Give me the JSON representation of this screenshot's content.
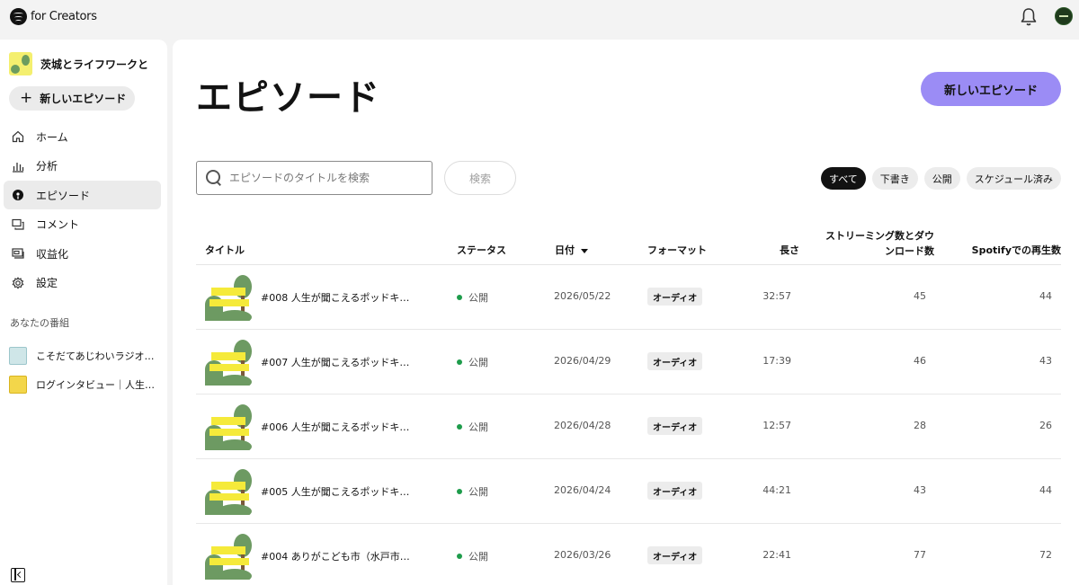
{
  "topbar": {
    "brand": "for Creators",
    "icons": [
      "spotify-logo-icon",
      "bell-icon",
      "avatar"
    ]
  },
  "sidebar": {
    "show_title": "茨城とライフワークと",
    "new_episode": "新しいエピソード",
    "nav": [
      {
        "label": "ホーム",
        "icon": "home-icon"
      },
      {
        "label": "分析",
        "icon": "chart-icon"
      },
      {
        "label": "エピソード",
        "icon": "podcast-icon",
        "active": true
      },
      {
        "label": "コメント",
        "icon": "comment-icon"
      },
      {
        "label": "収益化",
        "icon": "monetize-icon"
      },
      {
        "label": "設定",
        "icon": "gear-icon"
      }
    ],
    "section_label": "あなたの番組",
    "my_shows": [
      {
        "title": "こそだてあじわいラジオ…"
      },
      {
        "title": "ログインタビュー｜人生…"
      }
    ]
  },
  "main": {
    "title": "エピソード",
    "new_episode_button": "新しいエピソード",
    "search_placeholder": "エピソードのタイトルを検索",
    "search_button": "検索",
    "filters": [
      "すべて",
      "下書き",
      "公開",
      "スケジュール済み"
    ],
    "active_filter": "すべて",
    "columns": {
      "title": "タイトル",
      "status": "ステータス",
      "date": "日付",
      "format": "フォーマット",
      "length": "長さ",
      "streams_line1": "ストリーミング数とダウ",
      "streams_line2": "ンロード数",
      "plays": "Spotifyでの再生数"
    },
    "episodes": [
      {
        "title": "#008 人生が聞こえるポッドキ…",
        "status": "公開",
        "date": "2026/05/22",
        "format": "オーディオ",
        "length": "32:57",
        "streams": "45",
        "plays": "44"
      },
      {
        "title": "#007 人生が聞こえるポッドキ…",
        "status": "公開",
        "date": "2026/04/29",
        "format": "オーディオ",
        "length": "17:39",
        "streams": "46",
        "plays": "43"
      },
      {
        "title": "#006 人生が聞こえるポッドキ…",
        "status": "公開",
        "date": "2026/04/28",
        "format": "オーディオ",
        "length": "12:57",
        "streams": "28",
        "plays": "26"
      },
      {
        "title": "#005 人生が聞こえるポッドキ…",
        "status": "公開",
        "date": "2026/04/24",
        "format": "オーディオ",
        "length": "44:21",
        "streams": "43",
        "plays": "44"
      },
      {
        "title": "#004 ありがこども市（水戸市…",
        "status": "公開",
        "date": "2026/03/26",
        "format": "オーディオ",
        "length": "22:41",
        "streams": "77",
        "plays": "72"
      }
    ],
    "colors": {
      "accent": "#9b8cf5",
      "published_dot": "#1e9c4b"
    }
  }
}
